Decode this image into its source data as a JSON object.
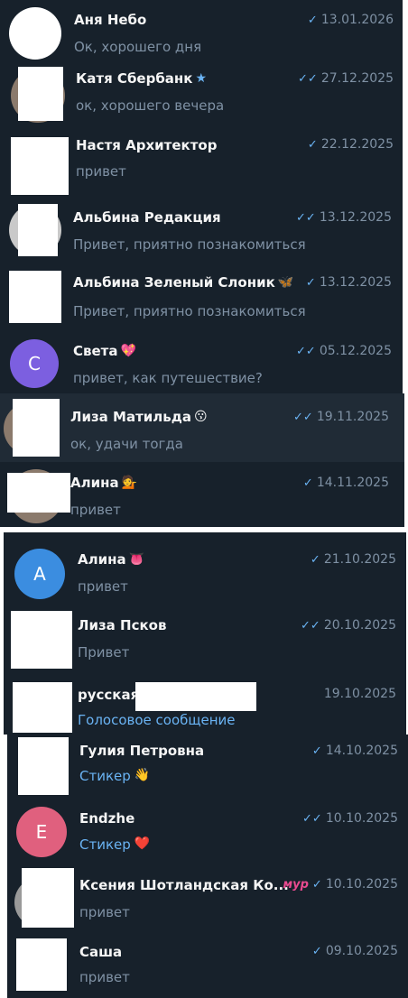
{
  "chats": [
    {
      "name": "Аня Небо",
      "message": "Ок, хорошего дня",
      "date": "13.01.2026",
      "status": "sent",
      "emoji": ""
    },
    {
      "name": "Катя Сбербанк",
      "message": "ок, хорошего вечера",
      "date": "27.12.2025",
      "status": "read",
      "emoji": "★"
    },
    {
      "name": "Настя Архитектор",
      "message": "привет",
      "date": "22.12.2025",
      "status": "sent",
      "emoji": ""
    },
    {
      "name": "Альбина Редакция",
      "message": "Привет, приятно познакомиться",
      "date": "13.12.2025",
      "status": "read",
      "emoji": ""
    },
    {
      "name": "Альбина Зеленый Слоник",
      "message": "Привет, приятно познакомиться",
      "date": "13.12.2025",
      "status": "sent",
      "emoji": "🦋"
    },
    {
      "name": "Света",
      "message": "привет, как путешествие?",
      "date": "05.12.2025",
      "status": "read",
      "emoji": "💖",
      "avatar_letter": "С",
      "avatar_color": "#7c5fe0"
    },
    {
      "name": "Лиза Матильда",
      "message": "ок, удачи тогда",
      "date": "19.11.2025",
      "status": "read",
      "emoji": "😗"
    },
    {
      "name": "Алина",
      "message": "привет",
      "date": "14.11.2025",
      "status": "sent",
      "emoji": "💁"
    },
    {
      "name": "Алина",
      "message": "привет",
      "date": "21.10.2025",
      "status": "sent",
      "emoji": "👅",
      "avatar_letter": "А",
      "avatar_color": "#3b8de0"
    },
    {
      "name": "Лиза Псков",
      "message": "Привет",
      "date": "20.10.2025",
      "status": "read",
      "emoji": ""
    },
    {
      "name": "русская",
      "message": "Голосовое сообщение",
      "date": "19.10.2025",
      "status": "none",
      "emoji": ""
    },
    {
      "name": "Гулия Петровна",
      "message": "Стикер",
      "date": "14.10.2025",
      "status": "sent",
      "emoji": "👋"
    },
    {
      "name": "Endzhe",
      "message": "Стикер",
      "date": "10.10.2025",
      "status": "read",
      "emoji": "❤️",
      "avatar_letter": "E",
      "avatar_color": "#e0607e"
    },
    {
      "name": "Ксения Шотландская Ко...",
      "message": "привет",
      "date": "10.10.2025",
      "status": "sent",
      "emoji": "",
      "badge": "мур"
    },
    {
      "name": "Саша",
      "message": "привет",
      "date": "09.10.2025",
      "status": "sent",
      "emoji": ""
    }
  ],
  "icons": {
    "sent": "single-check-icon",
    "read": "double-check-icon"
  },
  "colors": {
    "background": "#17212b",
    "selected": "#202b36",
    "accent": "#6ab3f3",
    "muted": "#7f91a4"
  }
}
